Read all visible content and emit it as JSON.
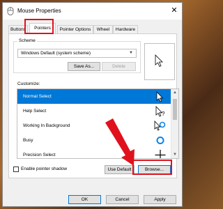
{
  "window": {
    "title": "Mouse Properties",
    "close_glyph": "✕"
  },
  "tabs": [
    {
      "label": "Buttons"
    },
    {
      "label": "Pointers"
    },
    {
      "label": "Pointer Options"
    },
    {
      "label": "Wheel"
    },
    {
      "label": "Hardware"
    }
  ],
  "scheme": {
    "group_label": "Scheme",
    "selected": "Windows Default (system scheme)",
    "save_as_label": "Save As...",
    "delete_label": "Delete"
  },
  "customize": {
    "label": "Customize:",
    "items": [
      {
        "label": "Normal Select",
        "icon": "arrow-cursor-icon"
      },
      {
        "label": "Help Select",
        "icon": "help-cursor-icon"
      },
      {
        "label": "Working In Background",
        "icon": "working-cursor-icon"
      },
      {
        "label": "Busy",
        "icon": "busy-cursor-icon"
      },
      {
        "label": "Precision Select",
        "icon": "crosshair-cursor-icon"
      }
    ]
  },
  "pointer_shadow_label": "Enable pointer shadow",
  "use_default_label": "Use Default",
  "browse_label": "Browse...",
  "footer": {
    "ok_label": "OK",
    "cancel_label": "Cancel",
    "apply_label": "Apply"
  },
  "colors": {
    "accent": "#0078d7",
    "highlight": "#e0111c"
  }
}
